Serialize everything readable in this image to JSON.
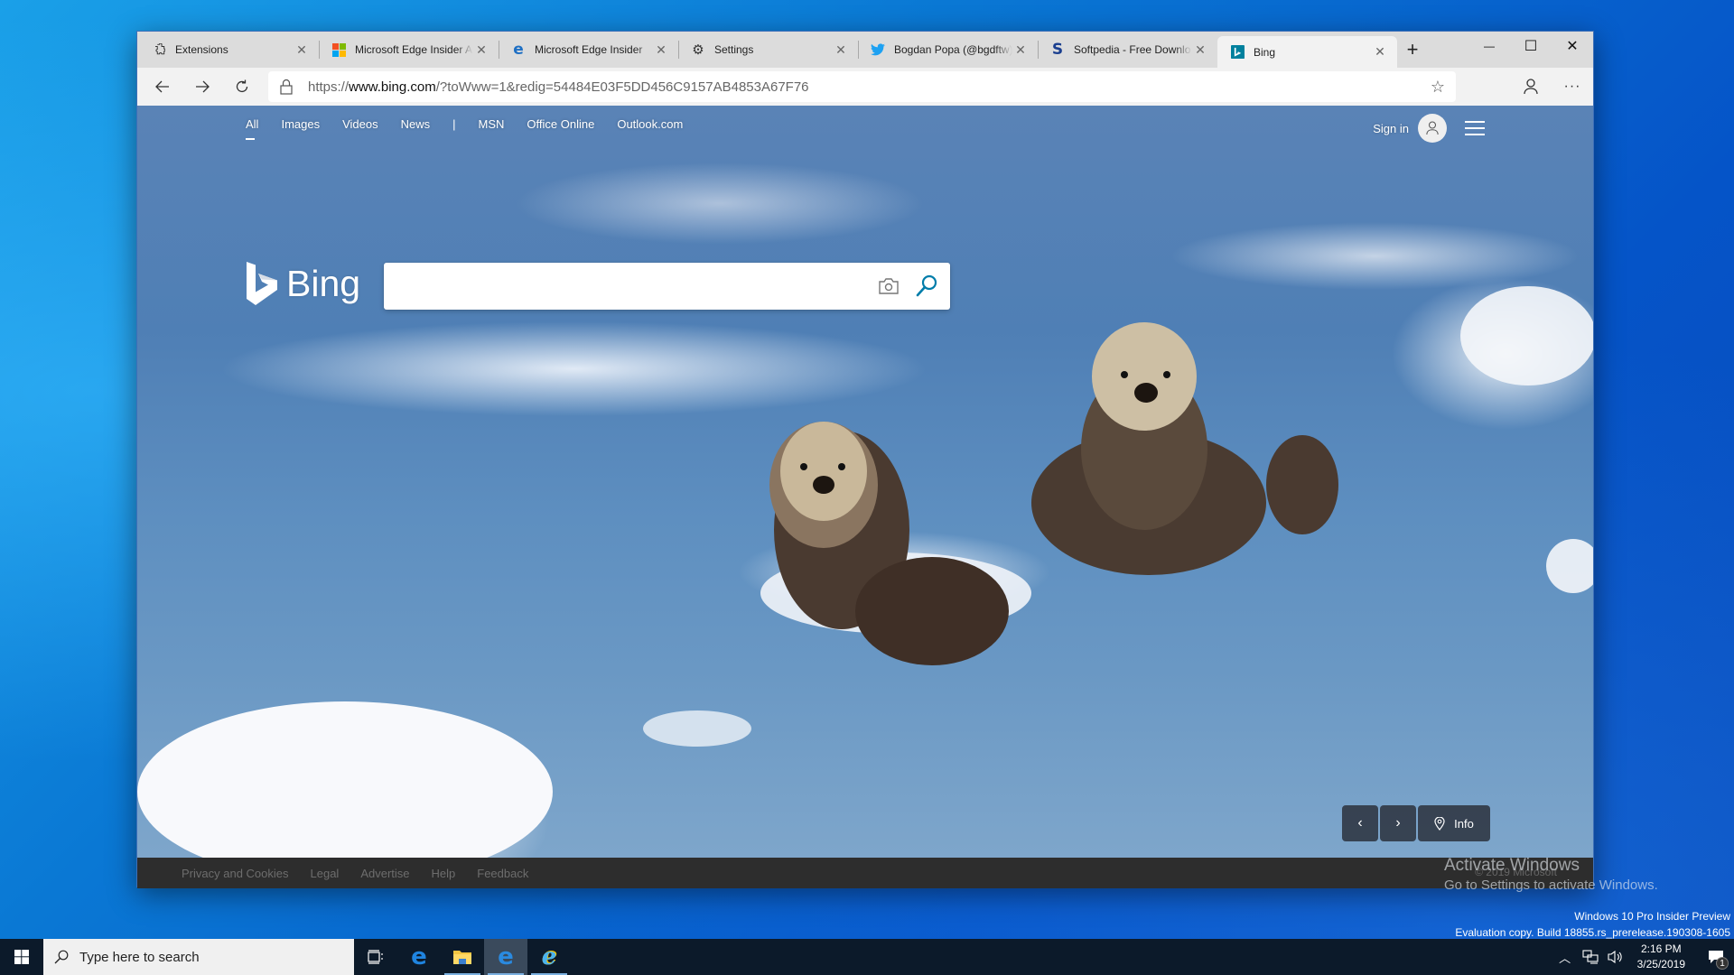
{
  "browser": {
    "tabs": [
      {
        "title": "Extensions",
        "icon": "puzzle-icon",
        "active": false
      },
      {
        "title": "Microsoft Edge Insider A",
        "icon": "microsoft-logo-icon",
        "active": false
      },
      {
        "title": "Microsoft Edge Insider",
        "icon": "edge-icon",
        "active": false
      },
      {
        "title": "Settings",
        "icon": "gear-icon",
        "active": false
      },
      {
        "title": "Bogdan Popa (@bgdftw)",
        "icon": "twitter-icon",
        "active": false
      },
      {
        "title": "Softpedia - Free Downlo",
        "icon": "softpedia-icon",
        "active": false
      },
      {
        "title": "Bing",
        "icon": "bing-icon",
        "active": true
      }
    ],
    "new_tab_label": "+",
    "window_controls": {
      "minimize": "—",
      "maximize": "☐",
      "close": "✕"
    },
    "address": {
      "scheme": "https://",
      "host": "www.bing.com",
      "path": "/?toWww=1&redig=54484E03F5DD456C9157AB4853A67F76"
    }
  },
  "bing": {
    "nav": [
      {
        "label": "All",
        "active": true
      },
      {
        "label": "Images"
      },
      {
        "label": "Videos"
      },
      {
        "label": "News"
      },
      {
        "label": "|",
        "separator": true
      },
      {
        "label": "MSN"
      },
      {
        "label": "Office Online"
      },
      {
        "label": "Outlook.com"
      }
    ],
    "sign_in": "Sign in",
    "logo_text": "Bing",
    "search": {
      "value": "",
      "placeholder": ""
    },
    "image_nav": {
      "info_label": "Info",
      "prev": "‹",
      "next": "›"
    },
    "footer": {
      "links": [
        "Privacy and Cookies",
        "Legal",
        "Advertise",
        "Help",
        "Feedback"
      ],
      "copyright": "© 2019 Microsoft"
    },
    "colors": {
      "accent": "#007daa",
      "footer_bg": "#2d2d2d"
    }
  },
  "desktop": {
    "watermark": {
      "title": "Activate Windows",
      "subtitle": "Go to Settings to activate Windows."
    },
    "build_info": {
      "line1": "Windows 10 Pro Insider Preview",
      "line2": "Evaluation copy. Build 18855.rs_prerelease.190308-1605"
    }
  },
  "taskbar": {
    "search_placeholder": "Type here to search",
    "apps": [
      {
        "name": "task-view",
        "running": false
      },
      {
        "name": "edge",
        "running": false
      },
      {
        "name": "file-explorer",
        "running": true
      },
      {
        "name": "edge-insider",
        "running": true,
        "active": true
      },
      {
        "name": "internet-explorer",
        "running": true
      }
    ],
    "time": "2:16 PM",
    "date": "3/25/2019",
    "notification_count": "1"
  }
}
